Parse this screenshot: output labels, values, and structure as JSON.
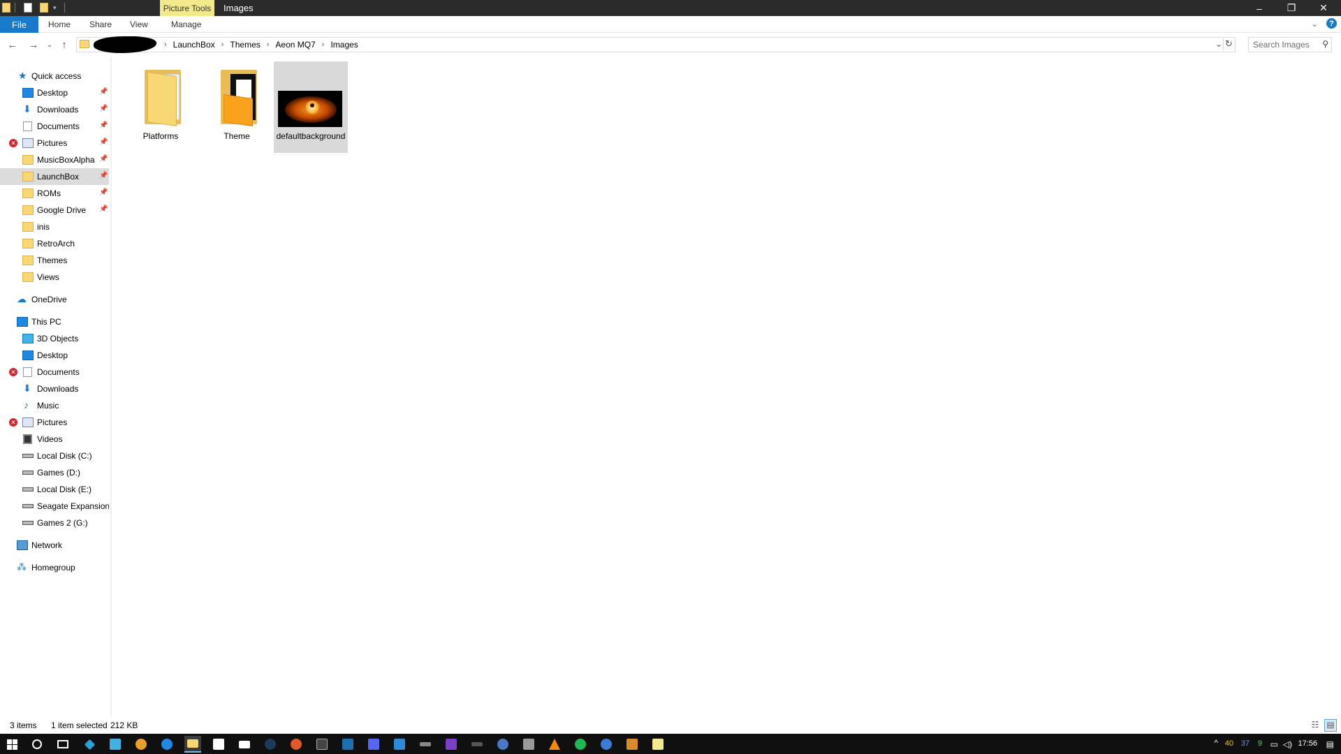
{
  "titlebar": {
    "context_tab": "Picture Tools",
    "title": "Images",
    "minimize": "–",
    "restore": "❐",
    "close": "✕"
  },
  "ribbon": {
    "file": "File",
    "home": "Home",
    "share": "Share",
    "view": "View",
    "manage": "Manage",
    "help": "?"
  },
  "address": {
    "crumbs": [
      "LaunchBox",
      "Themes",
      "Aeon MQ7",
      "Images"
    ],
    "separator": "›"
  },
  "search": {
    "placeholder": "Search Images"
  },
  "sidebar": {
    "items": [
      {
        "label": "Quick access",
        "icon": "star-icon"
      },
      {
        "label": "Desktop",
        "icon": "desktop-icon",
        "pinned": true
      },
      {
        "label": "Downloads",
        "icon": "downloads-icon",
        "pinned": true
      },
      {
        "label": "Documents",
        "icon": "documents-icon",
        "pinned": true
      },
      {
        "label": "Pictures",
        "icon": "pictures-icon",
        "pinned": true,
        "error": true
      },
      {
        "label": "MusicBoxAlpha",
        "icon": "folder-icon",
        "pinned": true
      },
      {
        "label": "LaunchBox",
        "icon": "folder-icon",
        "pinned": true,
        "selected": true
      },
      {
        "label": "ROMs",
        "icon": "folder-icon",
        "pinned": true
      },
      {
        "label": "Google Drive",
        "icon": "folder-icon",
        "pinned": true
      },
      {
        "label": "inis",
        "icon": "folder-icon"
      },
      {
        "label": "RetroArch",
        "icon": "folder-icon"
      },
      {
        "label": "Themes",
        "icon": "folder-icon"
      },
      {
        "label": "Views",
        "icon": "folder-icon"
      },
      {
        "label": "OneDrive",
        "icon": "cloud-icon"
      },
      {
        "label": "This PC",
        "icon": "pc-icon"
      },
      {
        "label": "3D Objects",
        "icon": "3d-objects-icon"
      },
      {
        "label": "Desktop",
        "icon": "desktop-icon"
      },
      {
        "label": "Documents",
        "icon": "documents-icon",
        "error": true
      },
      {
        "label": "Downloads",
        "icon": "downloads-icon"
      },
      {
        "label": "Music",
        "icon": "music-icon"
      },
      {
        "label": "Pictures",
        "icon": "pictures-icon",
        "error": true
      },
      {
        "label": "Videos",
        "icon": "videos-icon"
      },
      {
        "label": "Local Disk (C:)",
        "icon": "drive-icon"
      },
      {
        "label": "Games (D:)",
        "icon": "drive-icon"
      },
      {
        "label": "Local Disk (E:)",
        "icon": "drive-icon"
      },
      {
        "label": "Seagate Expansion I",
        "icon": "drive-icon"
      },
      {
        "label": "Games 2 (G:)",
        "icon": "drive-icon"
      },
      {
        "label": "Network",
        "icon": "network-icon"
      },
      {
        "label": "Homegroup",
        "icon": "homegroup-icon"
      }
    ]
  },
  "files": [
    {
      "name": "Platforms",
      "type": "folder"
    },
    {
      "name": "Theme",
      "type": "folder"
    },
    {
      "name": "defaultbackground",
      "type": "image",
      "selected": true
    }
  ],
  "status": {
    "items": "3 items",
    "selected": "1 item selected",
    "size": "212 KB"
  },
  "tray": {
    "n1": "40",
    "n2": "37",
    "n3": "9",
    "time": "17:56"
  },
  "colors": {
    "accent": "#1979ca",
    "context_tab": "#f2e98d",
    "selection": "#d9d9d9",
    "taskbar": "#101010"
  }
}
